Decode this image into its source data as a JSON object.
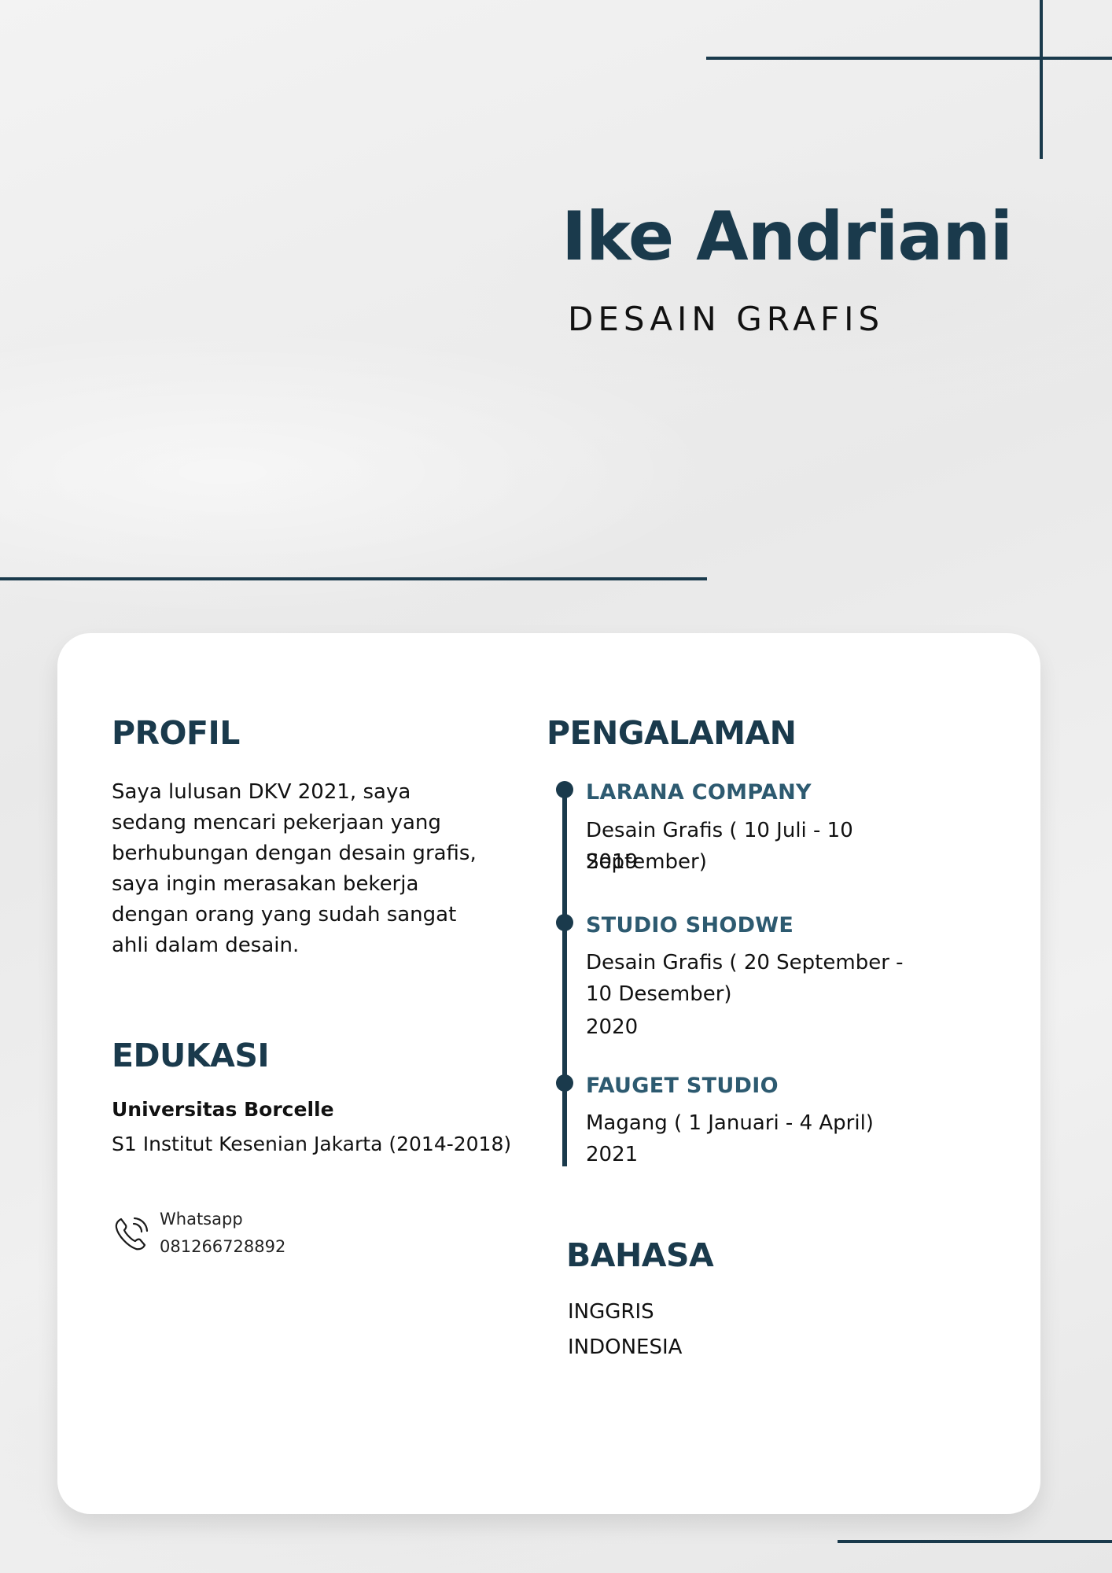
{
  "header": {
    "name": "Ike Andriani",
    "role": "DESAIN GRAFIS"
  },
  "profile": {
    "heading": "PROFIL",
    "text": "Saya lulusan DKV 2021, saya sedang mencari pekerjaan yang berhubungan dengan desain grafis, saya ingin merasakan bekerja dengan orang yang sudah sangat ahli dalam desain."
  },
  "education": {
    "heading": "EDUKASI",
    "school": "Universitas Borcelle",
    "detail": "S1 Institut Kesenian Jakarta (2014-2018)"
  },
  "contact": {
    "label": "Whatsapp",
    "phone": "081266728892",
    "icon": "phone-icon"
  },
  "experience": {
    "heading": "PENGALAMAN",
    "items": [
      {
        "company": "LARANA COMPANY",
        "role": "Desain Grafis ( 10 Juli - 10 September)",
        "year": "2019"
      },
      {
        "company": "STUDIO SHODWE",
        "role": "Desain Grafis ( 20 September - 10 Desember)",
        "year": "2020"
      },
      {
        "company": "FAUGET STUDIO",
        "role": "Magang ( 1 Januari - 4 April)",
        "year": "2021"
      }
    ]
  },
  "languages": {
    "heading": "BAHASA",
    "items": [
      "INGGRIS",
      "INDONESIA"
    ]
  },
  "colors": {
    "primary": "#1a3a4c",
    "accent": "#2d5a70",
    "card": "#ffffff"
  }
}
